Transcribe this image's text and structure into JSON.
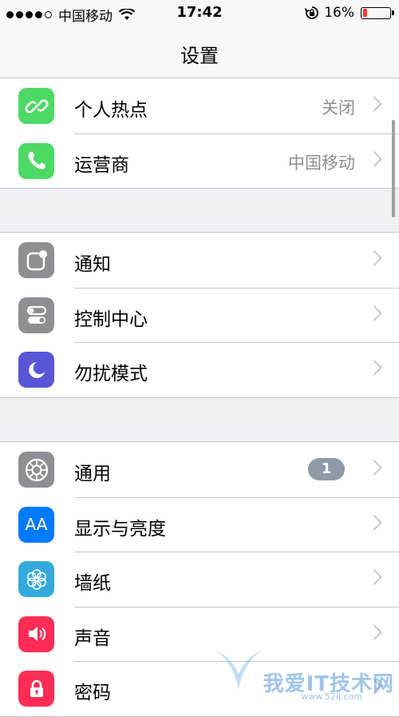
{
  "status_bar": {
    "carrier": "中国移动",
    "time": "17:42",
    "battery_percent": "16%",
    "battery_level": 0.16,
    "signal_bars": 4
  },
  "nav": {
    "title": "设置"
  },
  "groups": [
    {
      "rows": [
        {
          "label": "个人热点",
          "value": "关闭",
          "icon": "hotspot-icon",
          "color": "#4cd964"
        },
        {
          "label": "运营商",
          "value": "中国移动",
          "icon": "phone-icon",
          "color": "#4cd964"
        }
      ]
    },
    {
      "rows": [
        {
          "label": "通知",
          "icon": "notifications-icon",
          "color": "#8e8e93"
        },
        {
          "label": "控制中心",
          "icon": "control-center-icon",
          "color": "#8e8e93"
        },
        {
          "label": "勿扰模式",
          "icon": "moon-icon",
          "color": "#5856d6"
        }
      ]
    },
    {
      "rows": [
        {
          "label": "通用",
          "badge": "1",
          "icon": "gear-icon",
          "color": "#8e8e93"
        },
        {
          "label": "显示与亮度",
          "icon": "display-icon",
          "color": "#007aff",
          "icon_text": "AA"
        },
        {
          "label": "墙纸",
          "icon": "wallpaper-icon",
          "color": "#34aadc"
        },
        {
          "label": "声音",
          "icon": "speaker-icon",
          "color": "#ff2d55"
        },
        {
          "label": "密码",
          "icon": "lock-icon",
          "color": "#ff2d55"
        }
      ]
    }
  ],
  "watermark": {
    "text": "我爱IT技术网",
    "url": "www.52ij.com"
  }
}
